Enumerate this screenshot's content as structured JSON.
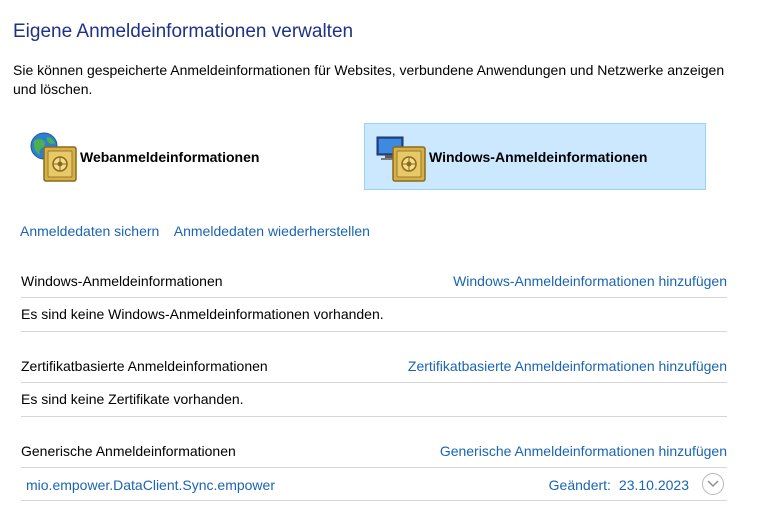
{
  "header": {
    "title": "Eigene Anmeldeinformationen verwalten",
    "description": "Sie können gespeicherte Anmeldeinformationen für Websites, verbundene Anwendungen und Netzwerke anzeigen und löschen."
  },
  "tiles": {
    "web": {
      "label": "Webanmeldeinformationen",
      "icon": "globe-vault-icon",
      "selected": false
    },
    "windows": {
      "label": "Windows-Anmeldeinformationen",
      "icon": "computer-vault-icon",
      "selected": true
    }
  },
  "actions": {
    "backup": "Anmeldedaten sichern",
    "restore": "Anmeldedaten wiederherstellen"
  },
  "sections": {
    "windows": {
      "title": "Windows-Anmeldeinformationen",
      "add_link": "Windows-Anmeldeinformationen hinzufügen",
      "empty_text": "Es sind keine Windows-Anmeldeinformationen vorhanden."
    },
    "certificate": {
      "title": "Zertifikatbasierte Anmeldeinformationen",
      "add_link": "Zertifikatbasierte Anmeldeinformationen hinzufügen",
      "empty_text": "Es sind keine Zertifikate vorhanden."
    },
    "generic": {
      "title": "Generische Anmeldeinformationen",
      "add_link": "Generische Anmeldeinformationen hinzufügen",
      "items": [
        {
          "name": "mio.empower.DataClient.Sync.empower",
          "modified_label": "Geändert:",
          "modified_date": "23.10.2023",
          "expander_icon": "chevron-down-icon"
        }
      ]
    }
  },
  "colors": {
    "title": "#1e3287",
    "link": "#1a64b4",
    "selected_tile_bg": "#cce8ff",
    "selected_tile_border": "#99d1ff",
    "divider": "#d6d6d6"
  }
}
